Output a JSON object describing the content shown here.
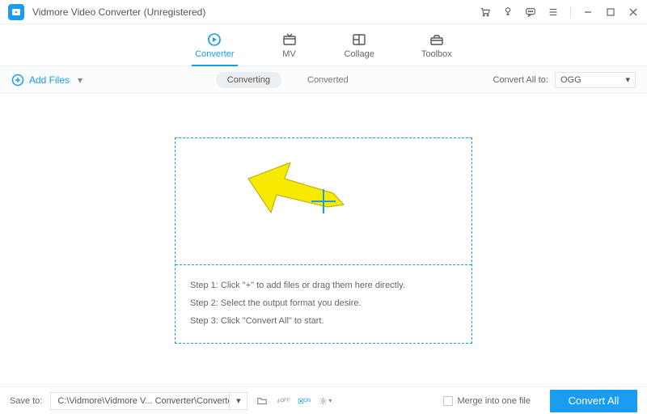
{
  "title": "Vidmore Video Converter (Unregistered)",
  "tabs": [
    {
      "label": "Converter"
    },
    {
      "label": "MV"
    },
    {
      "label": "Collage"
    },
    {
      "label": "Toolbox"
    }
  ],
  "toolbar": {
    "add_files": "Add Files",
    "converting": "Converting",
    "converted": "Converted",
    "convert_all_to": "Convert All to:",
    "format": "OGG"
  },
  "steps": {
    "s1": "Step 1: Click \"+\" to add files or drag them here directly.",
    "s2": "Step 2: Select the output format you desire.",
    "s3": "Step 3: Click \"Convert All\" to start."
  },
  "footer": {
    "save_to": "Save to:",
    "path": "C:\\Vidmore\\Vidmore V... Converter\\Converted",
    "merge": "Merge into one file",
    "convert_all": "Convert All"
  }
}
